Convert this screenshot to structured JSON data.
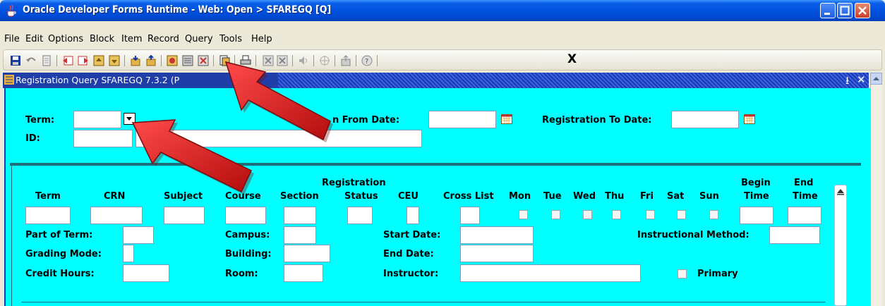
{
  "window": {
    "title": "Oracle Developer Forms Runtime - Web:  Open > SFAREGQ [Q]"
  },
  "menu": [
    "File",
    "Edit",
    "Options",
    "Block",
    "Item",
    "Record",
    "Query",
    "Tools",
    "Help"
  ],
  "toolbar": {
    "exit_label": "X"
  },
  "form_window": {
    "title": "Registration Query  SFAREGQ  7.3.2  (P"
  },
  "key_block": {
    "term_label": "Term:",
    "term_value": "",
    "id_label": "ID:",
    "id_value": "",
    "name_value": "",
    "reg_from_label": "n From Date:",
    "reg_from_value": "",
    "reg_to_label": "Registration To Date:",
    "reg_to_value": ""
  },
  "columns": {
    "term": "Term",
    "crn": "CRN",
    "subject": "Subject",
    "course": "Course",
    "section": "Section",
    "reg_status_1": "Registration",
    "reg_status_2": "Status",
    "ceu": "CEU",
    "cross_list": "Cross List",
    "mon": "Mon",
    "tue": "Tue",
    "wed": "Wed",
    "thu": "Thu",
    "fri": "Fri",
    "sat": "Sat",
    "sun": "Sun",
    "begin_1": "Begin",
    "begin_2": "Time",
    "end_1": "End",
    "end_2": "Time"
  },
  "detail": {
    "part_of_term_label": "Part of Term:",
    "grading_mode_label": "Grading Mode:",
    "credit_hours_label": "Credit Hours:",
    "campus_label": "Campus:",
    "building_label": "Building:",
    "room_label": "Room:",
    "start_date_label": "Start Date:",
    "end_date_label": "End Date:",
    "instructor_label": "Instructor:",
    "instructional_method_label": "Instructional Method:",
    "primary_label": "Primary"
  },
  "colors": {
    "form_background": "#00ffff",
    "title_bar": "#0053e0",
    "annotation_arrow": "#e01b1b"
  }
}
